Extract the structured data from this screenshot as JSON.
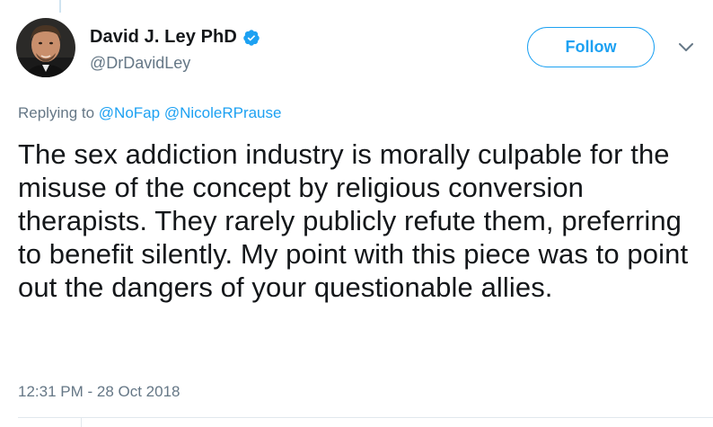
{
  "author": {
    "display_name": "David J. Ley PhD",
    "handle": "@DrDavidLey",
    "verified": true,
    "avatar_icon": "profile-photo"
  },
  "follow_button": {
    "label": "Follow"
  },
  "menu_icon": "chevron-down-icon",
  "reply": {
    "prefix": "Replying to",
    "mentions": [
      "@NoFap",
      "@NicoleRPrause"
    ]
  },
  "tweet": {
    "text": "The sex addiction industry is morally culpable for the misuse of the concept by religious conversion therapists. They rarely publicly refute them, preferring to benefit silently. My point with this piece was to point out the dangers of your questionable allies.",
    "timestamp": "12:31 PM - 28 Oct 2018"
  },
  "colors": {
    "accent": "#1da1f2",
    "text": "#14171a",
    "secondary_text": "#657786",
    "divider": "#e1e8ed"
  }
}
